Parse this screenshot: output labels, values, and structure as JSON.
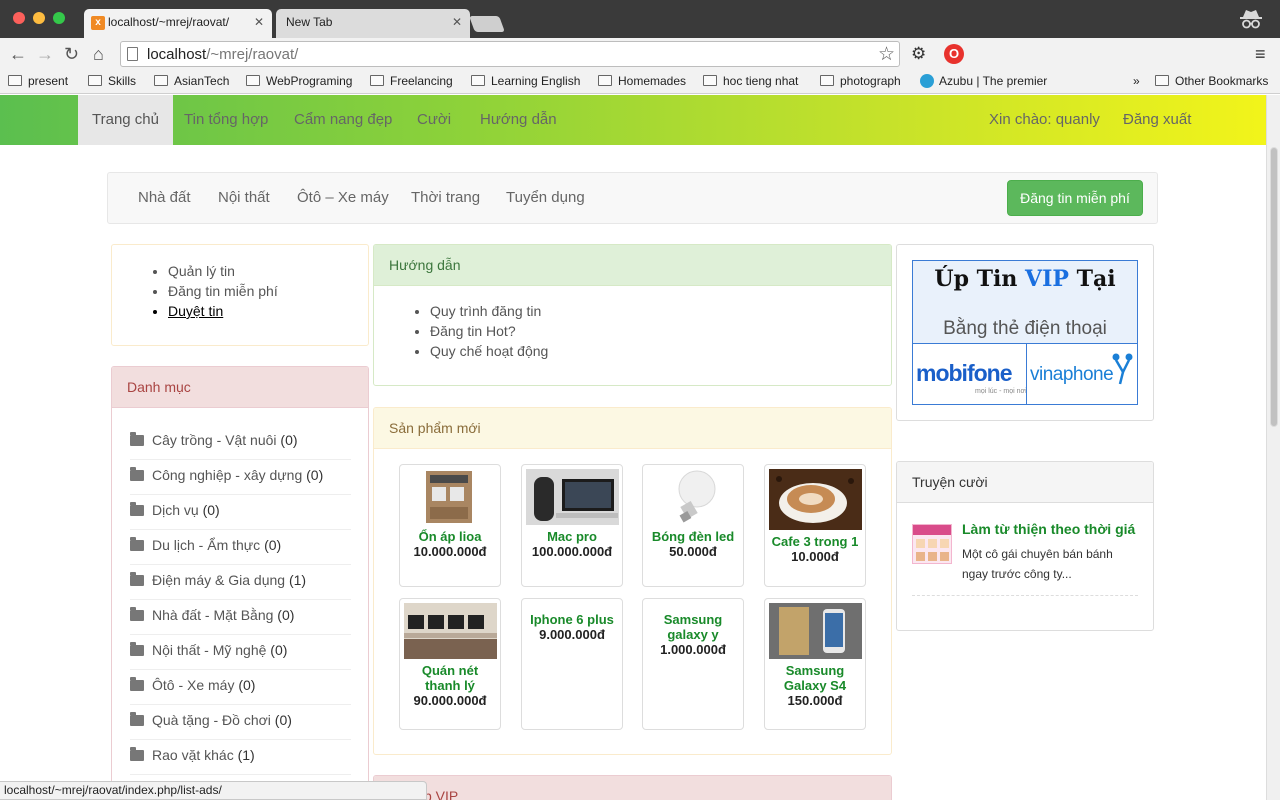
{
  "browser": {
    "tabs": [
      {
        "title": "localhost/~mrej/raovat/",
        "active": true
      },
      {
        "title": "New Tab",
        "active": false
      }
    ],
    "address": {
      "host": "localhost",
      "path": "/~mrej/raovat/"
    },
    "bookmarks": [
      "present",
      "Skills",
      "AsianTech",
      "WebPrograming",
      "Freelancing",
      "Learning English",
      "Homemades",
      "hoc tieng nhat",
      "photograph",
      "Azubu | The premier",
      "Other Bookmarks"
    ],
    "bookmarks_overflow": "»",
    "status_url": "localhost/~mrej/raovat/index.php/list-ads/"
  },
  "site_nav": {
    "items": [
      "Trang chủ",
      "Tin tổng hợp",
      "Cẩm nang đẹp",
      "Cười",
      "Hướng dẫn"
    ],
    "greeting": "Xin chào: quanly",
    "logout": "Đăng xuất"
  },
  "category_bar": {
    "items": [
      "Nhà đất",
      "Nội thất",
      "Ôtô – Xe máy",
      "Thời trang",
      "Tuyển dụng"
    ],
    "post_button": "Đăng tin miễn phí"
  },
  "user_menu": {
    "items": [
      "Quản lý tin",
      "Đăng tin miễn phí",
      "Duyệt tin"
    ]
  },
  "categories": {
    "title": "Danh mục",
    "items": [
      {
        "name": "Cây trồng - Vật nuôi",
        "count": "(0)"
      },
      {
        "name": "Công nghiệp - xây dựng",
        "count": "(0)"
      },
      {
        "name": "Dịch vụ",
        "count": "(0)"
      },
      {
        "name": "Du lịch - Ẩm thực",
        "count": "(0)"
      },
      {
        "name": "Điện máy & Gia dụng",
        "count": "(1)"
      },
      {
        "name": "Nhà đất - Mặt Bằng",
        "count": "(0)"
      },
      {
        "name": "Nội thất - Mỹ nghệ",
        "count": "(0)"
      },
      {
        "name": "Ôtô - Xe máy",
        "count": "(0)"
      },
      {
        "name": "Quà tặng - Đồ chơi",
        "count": "(0)"
      },
      {
        "name": "Rao vặt khác",
        "count": "(1)"
      }
    ]
  },
  "guide": {
    "title": "Hướng dẫn",
    "items": [
      "Quy trình đăng tin",
      "Đăng tin Hot?",
      "Quy chế hoạt động"
    ]
  },
  "new_products": {
    "title": "Sản phẩm mới",
    "items": [
      {
        "name": "Ổn áp lioa",
        "price": "10.000.000đ",
        "image": "voltage-regulator"
      },
      {
        "name": "Mac pro",
        "price": "100.000.000đ",
        "image": "mac-pro"
      },
      {
        "name": "Bóng đèn led",
        "price": "50.000đ",
        "image": "led-bulb"
      },
      {
        "name": "Cafe 3 trong 1",
        "price": "10.000đ",
        "image": "coffee-cup"
      },
      {
        "name": "Quán nét thanh lý",
        "price": "90.000.000đ",
        "image": "internet-cafe"
      },
      {
        "name": "Iphone 6 plus",
        "price": "9.000.000đ",
        "image": ""
      },
      {
        "name": "Samsung galaxy y",
        "price": "1.000.000đ",
        "image": ""
      },
      {
        "name": "Samsung Galaxy S4",
        "price": "150.000đ",
        "image": "galaxy-s4"
      }
    ]
  },
  "vip_panel": {
    "title": "p VIP"
  },
  "ad": {
    "title_prefix": "Úp Tin",
    "title_vip": "VIP",
    "title_suffix": "Tại",
    "subtitle": "Bằng thẻ điện thoại",
    "brand1": "mobifone",
    "brand1_sub": "mọi lúc - mọi nơi",
    "brand2": "vinaphone"
  },
  "jokes": {
    "title": "Truyện cười",
    "items": [
      {
        "title": "Làm từ thiện theo thời giá",
        "desc": "Một cô gái chuyên bán bánh ngay trước công ty..."
      }
    ]
  },
  "colors": {
    "nav_gradient_start": "#5bbf4f",
    "nav_gradient_end": "#f2f41a",
    "product_name": "#198a2a",
    "success_button": "#5cb85c"
  }
}
